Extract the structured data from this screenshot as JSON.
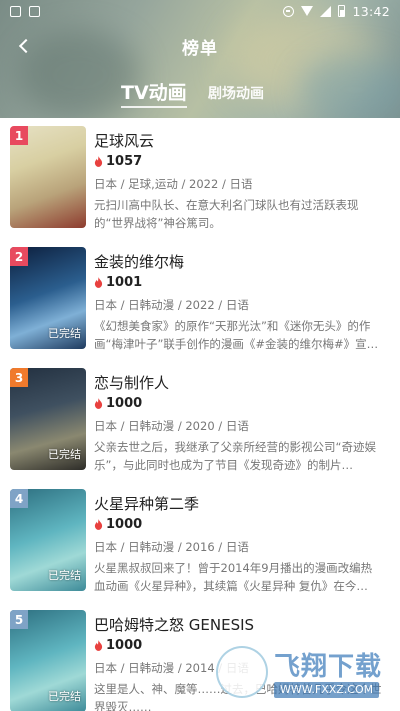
{
  "status_bar": {
    "time": "13:42"
  },
  "header": {
    "title": "榜单",
    "back_icon": "back-arrow-icon"
  },
  "tabs": [
    {
      "label": "TV动画",
      "active": true
    },
    {
      "label": "剧场动画",
      "active": false
    }
  ],
  "list": [
    {
      "rank": "1",
      "rank_color": "#e84a5f",
      "title": "足球风云",
      "heat": "1057",
      "meta": "日本 / 足球,运动 / 2022 / 日语",
      "desc": "元扫川高中队长、在意大利名门球队也有过活跃表现的“世界战将”神谷篤司。",
      "cover_tag": ""
    },
    {
      "rank": "2",
      "rank_color": "#e84a5f",
      "title": "金装的维尔梅",
      "heat": "1001",
      "meta": "日本 / 日韩动漫 / 2022 / 日语",
      "desc": "《幻想美食家》的原作“天那光汰”和《迷你无头》的作画“梅津叶子”联手创作的漫画《#金装的维尔梅#》宣…",
      "cover_tag": "已完结"
    },
    {
      "rank": "3",
      "rank_color": "#f07a2c",
      "title": "恋与制作人",
      "heat": "1000",
      "meta": "日本 / 日韩动漫 / 2020 / 日语",
      "desc": "父亲去世之后，我继承了父亲所经营的影视公司“奇迹娱乐”，与此同时也成为了节目《发现奇迹》的制片…",
      "cover_tag": "已完结"
    },
    {
      "rank": "4",
      "rank_color": "#7fa3c6",
      "title": "火星异种第二季",
      "heat": "1000",
      "meta": "日本 / 日韩动漫 / 2016 / 日语",
      "desc": "火星黑叔叔回来了！曾于2014年9月播出的漫画改编热血动画《火星异种》，其续篇《火星异种 复仇》在今…",
      "cover_tag": "已完结"
    },
    {
      "rank": "5",
      "rank_color": "#7fa3c6",
      "title": "巴哈姆特之怒  GENESIS",
      "heat": "1000",
      "meta": "日本 / 日韩动漫 / 2014 / 日语",
      "desc": "这里是人、神、魔等……过去，巴哈姆特曾几乎令这个世界毁灭……",
      "cover_tag": "已完结"
    }
  ],
  "icons": {
    "heat": "flame-icon"
  },
  "watermark": {
    "text": "飞翔下载",
    "url": "WWW.FXXZ.COM"
  }
}
